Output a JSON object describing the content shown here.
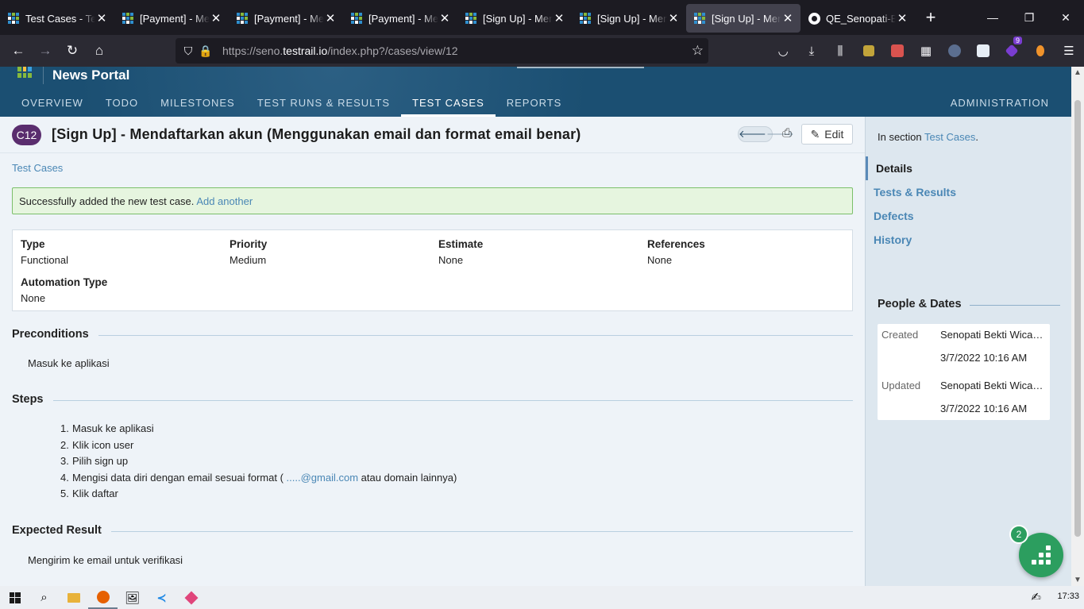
{
  "browser": {
    "tabs": [
      {
        "title": "Test Cases - TestRail",
        "active": false,
        "icon": "testrail-icon"
      },
      {
        "title": "[Payment] - Melakukan",
        "active": false,
        "icon": "testrail-icon"
      },
      {
        "title": "[Payment] - Melakukan",
        "active": false,
        "icon": "testrail-icon"
      },
      {
        "title": "[Payment] - Melakukan",
        "active": false,
        "icon": "testrail-icon"
      },
      {
        "title": "[Sign Up] - Mendaftarkan",
        "active": false,
        "icon": "testrail-icon"
      },
      {
        "title": "[Sign Up] - Mendaftarkan",
        "active": false,
        "icon": "testrail-icon"
      },
      {
        "title": "[Sign Up] - Mendaftarkan",
        "active": true,
        "icon": "testrail-icon"
      },
      {
        "title": "QE_Senopati-Bekti",
        "active": false,
        "icon": "github-icon"
      }
    ],
    "url_prefix": "https://seno.",
    "url_host": "testrail.io",
    "url_path": "/index.php?/cases/view/12"
  },
  "app": {
    "project_name": "News Portal",
    "nav": [
      {
        "label": "OVERVIEW",
        "active": false
      },
      {
        "label": "TODO",
        "active": false
      },
      {
        "label": "MILESTONES",
        "active": false
      },
      {
        "label": "TEST RUNS & RESULTS",
        "active": false
      },
      {
        "label": "TEST CASES",
        "active": true
      },
      {
        "label": "REPORTS",
        "active": false
      }
    ],
    "admin_label": "ADMINISTRATION"
  },
  "case": {
    "id": "C12",
    "title": "[Sign Up] - Mendaftarkan akun (Menggunakan email dan format email benar)",
    "edit_label": "Edit",
    "breadcrumb": "Test Cases",
    "alert_text": "Successfully added the new test case.",
    "alert_link": "Add another",
    "fields": {
      "type_label": "Type",
      "type_value": "Functional",
      "priority_label": "Priority",
      "priority_value": "Medium",
      "estimate_label": "Estimate",
      "estimate_value": "None",
      "references_label": "References",
      "references_value": "None",
      "automation_label": "Automation Type",
      "automation_value": "None"
    },
    "preconditions_label": "Preconditions",
    "preconditions_text": "Masuk ke aplikasi",
    "steps_label": "Steps",
    "steps": [
      {
        "n": "1.",
        "text": "Masuk ke aplikasi"
      },
      {
        "n": "2.",
        "text": "Klik icon user"
      },
      {
        "n": "3.",
        "text": "Pilih sign up"
      },
      {
        "n": "4.",
        "text_before": "Mengisi data diri dengan email sesuai format ( ",
        "link": ".....@gmail.com",
        "text_after": " atau domain lainnya)"
      },
      {
        "n": "5.",
        "text": "Klik daftar"
      }
    ],
    "expected_label": "Expected Result",
    "expected_text": "Mengirim ke email untuk verifikasi"
  },
  "sidebar": {
    "in_section_prefix": "In section ",
    "in_section_link": "Test Cases",
    "in_section_suffix": ".",
    "menu": [
      {
        "label": "Details",
        "active": true
      },
      {
        "label": "Tests & Results",
        "active": false
      },
      {
        "label": "Defects",
        "active": false
      },
      {
        "label": "History",
        "active": false
      }
    ],
    "people_dates_label": "People & Dates",
    "created_label": "Created",
    "created_by": "Senopati Bekti Wicaksono",
    "created_at": "3/7/2022 10:16 AM",
    "updated_label": "Updated",
    "updated_by": "Senopati Bekti Wicaksono",
    "updated_at": "3/7/2022 10:16 AM"
  },
  "fab_count": "2",
  "taskbar": {
    "time": "17:33"
  },
  "colors": {
    "header": "#1b4f72",
    "link": "#4a87b5",
    "case_id_badge": "#5a2d6e",
    "success_bg": "#e6f5df",
    "fab": "#2c9e5f"
  }
}
